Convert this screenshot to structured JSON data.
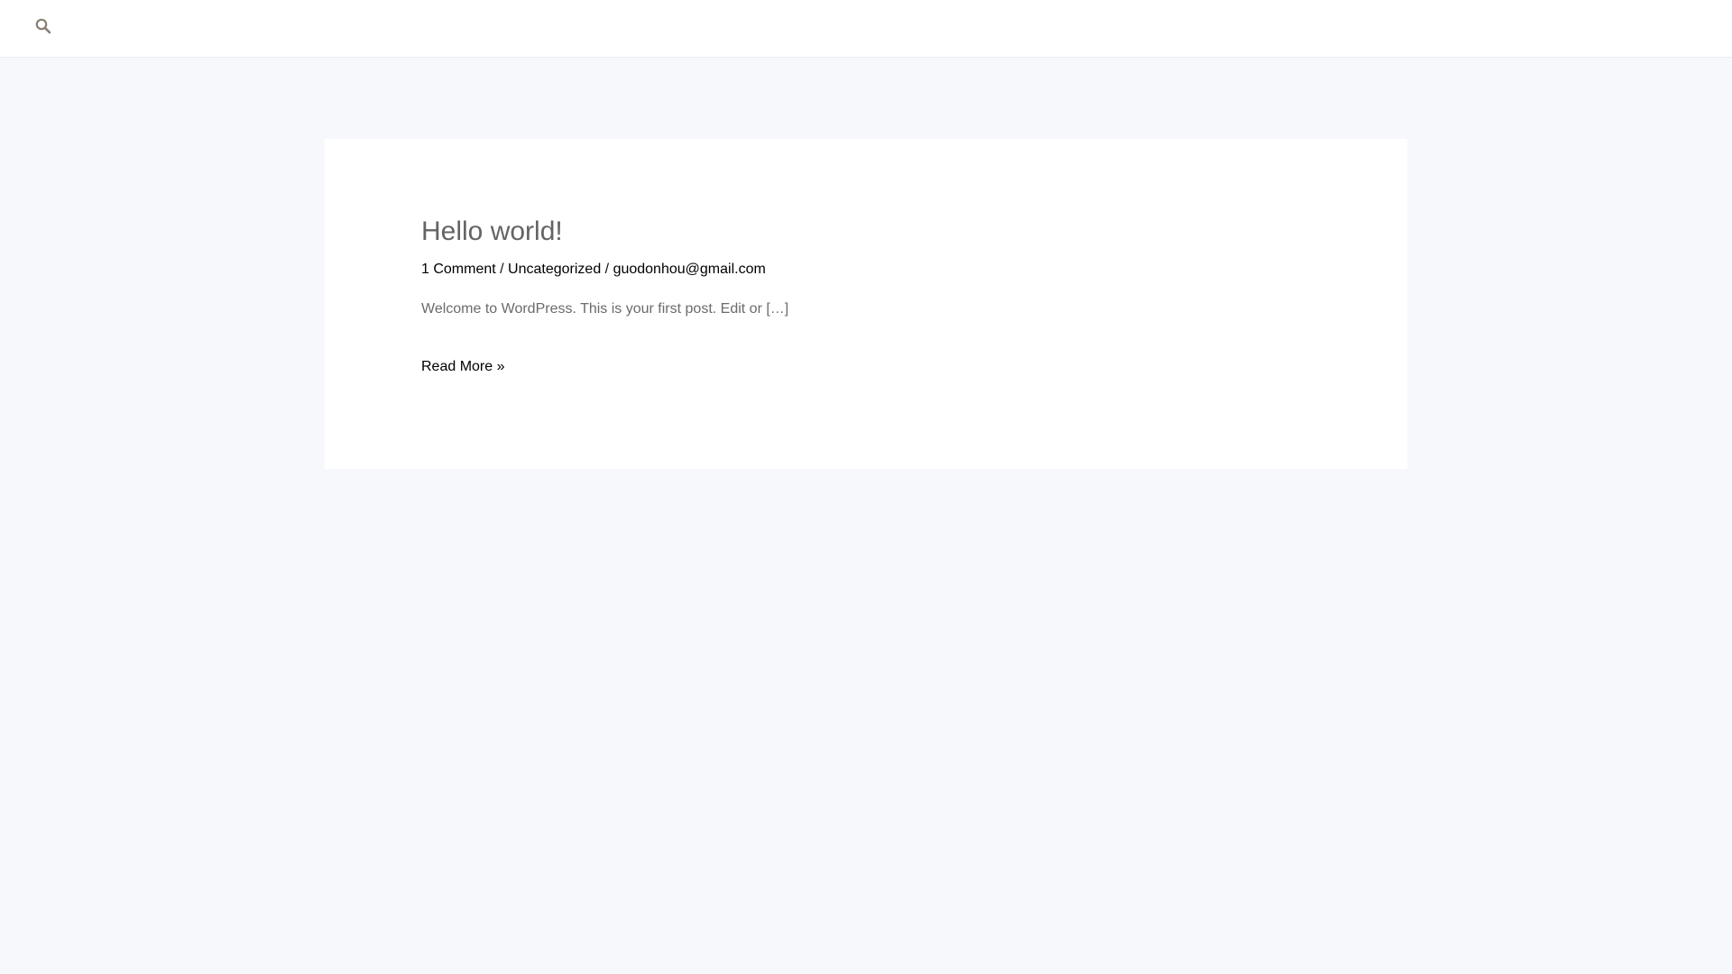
{
  "header": {
    "search_icon": "search-icon",
    "icon_color": "#8a7f72"
  },
  "post": {
    "title": "Hello world!",
    "meta": {
      "comments": "1 Comment",
      "separator": " / ",
      "category": "Uncategorized",
      "author": "guodonhou@gmail.com"
    },
    "excerpt": "Welcome to WordPress. This is your first post. Edit or […]",
    "read_more": "Read More »"
  }
}
